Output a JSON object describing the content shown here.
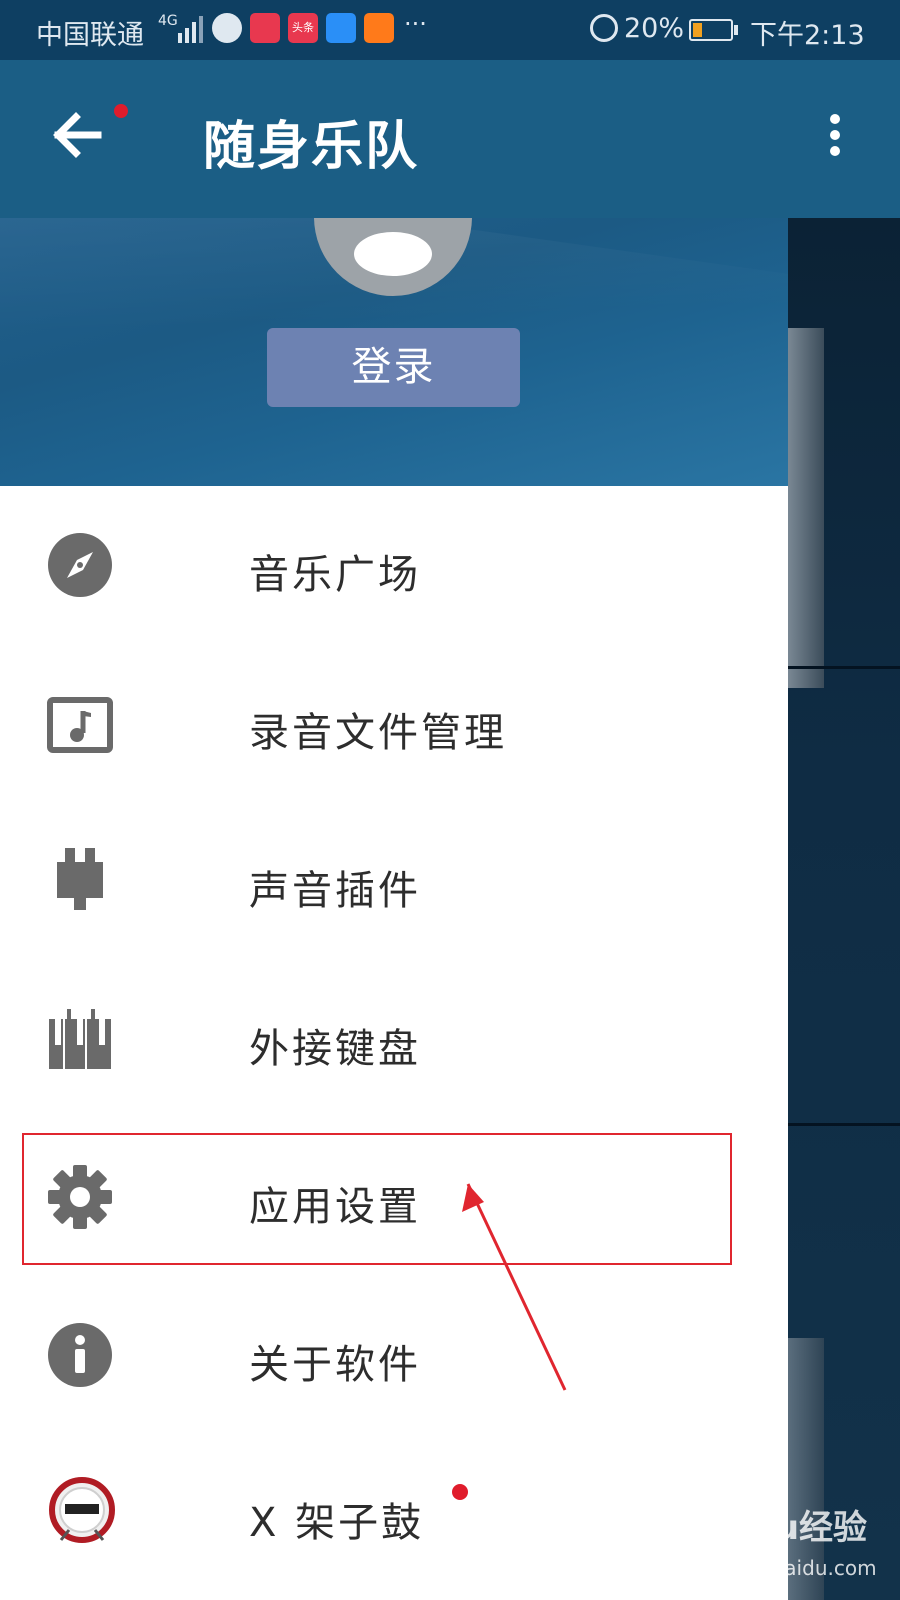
{
  "status_bar": {
    "carrier": "中国联通",
    "network": "4G",
    "apps": [
      {
        "name": "app-a",
        "label": "",
        "color": "#e8384f"
      },
      {
        "name": "toutiao",
        "label": "头条",
        "color": "#e8384f"
      },
      {
        "name": "youku",
        "label": "",
        "color": "#2a8ff7"
      },
      {
        "name": "app-d",
        "label": "",
        "color": "#ff7a1a"
      }
    ],
    "more": "···",
    "battery_percent": "20%",
    "battery_level": 0.2,
    "time": "下午2:13"
  },
  "app_bar": {
    "title": "随身乐队",
    "back_icon": "back-arrow-icon",
    "menu_icon": "more-vert-icon"
  },
  "drawer": {
    "login_label": "登录",
    "items": [
      {
        "label": "音乐广场",
        "icon": "compass-icon"
      },
      {
        "label": "录音文件管理",
        "icon": "music-file-icon"
      },
      {
        "label": "声音插件",
        "icon": "plugin-icon"
      },
      {
        "label": "外接键盘",
        "icon": "keyboard-icon"
      },
      {
        "label": "应用设置",
        "icon": "gear-icon"
      },
      {
        "label": "关于软件",
        "icon": "info-icon"
      },
      {
        "label": "X 架子鼓",
        "icon": "drum-icon"
      }
    ]
  },
  "annotation": {
    "highlighted_item": "应用设置",
    "color": "#e0262f"
  },
  "watermark": {
    "main": "Baidu经验",
    "sub": "jingyan.baidu.com"
  },
  "colors": {
    "app_bar": "#1b5e85",
    "status_bar": "#0e3f62",
    "icon_gray": "#6a6a6a",
    "accent_red": "#e01c2c"
  }
}
